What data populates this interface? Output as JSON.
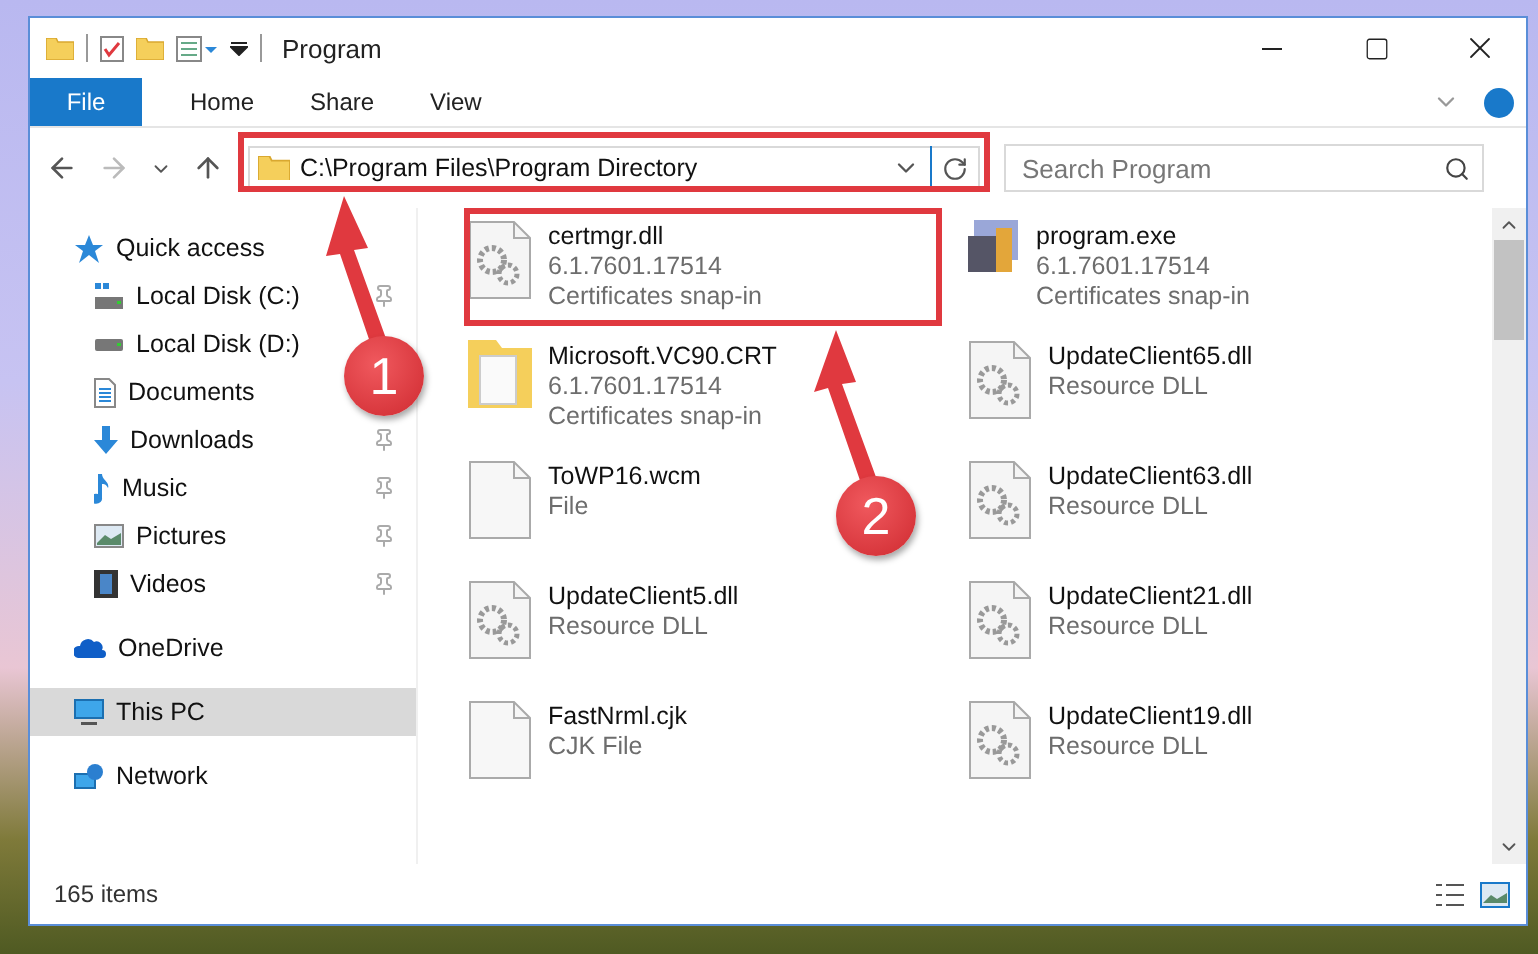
{
  "window": {
    "title": "Program"
  },
  "ribbon_tabs": [
    {
      "label": "File",
      "selected": true
    },
    {
      "label": "Home",
      "selected": false
    },
    {
      "label": "Share",
      "selected": false
    },
    {
      "label": "View",
      "selected": false
    }
  ],
  "address": {
    "path": "C:\\Program Files\\Program Directory"
  },
  "search": {
    "placeholder": "Search Program"
  },
  "sidebar": {
    "items": [
      {
        "label": "Quick access",
        "kind": "star",
        "selected": false,
        "children": [
          {
            "label": "Local Disk (C:)",
            "kind": "system-drive",
            "pinned": true,
            "selected": false
          },
          {
            "label": "Local Disk (D:)",
            "kind": "drive",
            "pinned": false,
            "selected": false
          },
          {
            "label": "Documents",
            "kind": "documents",
            "pinned": false,
            "selected": false
          },
          {
            "label": "Downloads",
            "kind": "downloads",
            "pinned": true,
            "selected": false
          },
          {
            "label": "Music",
            "kind": "music",
            "pinned": true,
            "selected": false
          },
          {
            "label": "Pictures",
            "kind": "pictures",
            "pinned": true,
            "selected": false
          },
          {
            "label": "Videos",
            "kind": "videos",
            "pinned": true,
            "selected": false
          }
        ]
      },
      {
        "label": "OneDrive",
        "kind": "cloud",
        "selected": false
      },
      {
        "label": "This PC",
        "kind": "pc",
        "selected": true
      },
      {
        "label": "Network",
        "kind": "network",
        "selected": false
      }
    ]
  },
  "files": [
    {
      "name": "certmgr.dll",
      "details": [
        "6.1.7601.17514",
        "Certificates snap-in"
      ],
      "kind": "dll"
    },
    {
      "name": "program.exe",
      "details": [
        "6.1.7601.17514",
        "Certificates snap-in"
      ],
      "kind": "exe"
    },
    {
      "name": "Microsoft.VC90.CRT",
      "details": [
        "6.1.7601.17514",
        "Certificates snap-in"
      ],
      "kind": "folder"
    },
    {
      "name": "UpdateClient65.dll",
      "details": [
        "Resource DLL"
      ],
      "kind": "dll"
    },
    {
      "name": "ToWP16.wcm",
      "details": [
        "File"
      ],
      "kind": "file"
    },
    {
      "name": "UpdateClient63.dll",
      "details": [
        "Resource DLL"
      ],
      "kind": "dll"
    },
    {
      "name": "UpdateClient5.dll",
      "details": [
        "Resource DLL"
      ],
      "kind": "dll"
    },
    {
      "name": "UpdateClient21.dll",
      "details": [
        "Resource DLL"
      ],
      "kind": "dll"
    },
    {
      "name": "FastNrml.cjk",
      "details": [
        "CJK File"
      ],
      "kind": "file"
    },
    {
      "name": "UpdateClient19.dll",
      "details": [
        "Resource DLL"
      ],
      "kind": "dll"
    }
  ],
  "status_bar": {
    "count": "165 items"
  },
  "annotations": {
    "markers": [
      {
        "number": "1"
      },
      {
        "number": "2"
      }
    ]
  }
}
